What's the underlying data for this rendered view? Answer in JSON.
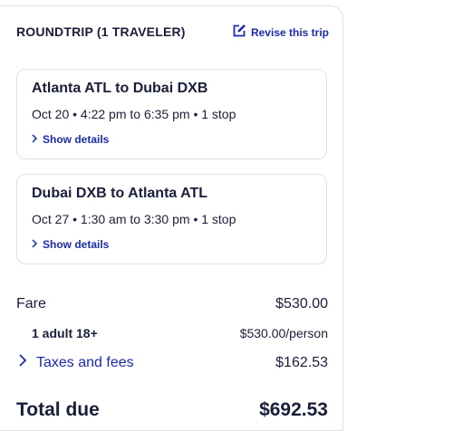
{
  "header": {
    "title": "ROUNDTRIP (1 TRAVELER)",
    "revise_label": "Revise this trip"
  },
  "legs": [
    {
      "route": "Atlanta ATL to Dubai DXB",
      "times": "Oct 20 • 4:22 pm to 6:35 pm • 1 stop",
      "details_label": "Show details"
    },
    {
      "route": "Dubai DXB to Atlanta ATL",
      "times": "Oct 27 • 1:30 am to 3:30 pm • 1 stop",
      "details_label": "Show details"
    }
  ],
  "price": {
    "fare_label": "Fare",
    "fare_value": "$530.00",
    "adult_label": "1 adult 18+",
    "adult_value": "$530.00/person",
    "taxes_label": "Taxes and fees",
    "taxes_value": "$162.53",
    "total_label": "Total due",
    "total_value": "$692.53"
  },
  "icons": {
    "revise": "edit-icon",
    "details": "chevron-right-icon",
    "taxes": "chevron-right-icon"
  },
  "colors": {
    "link": "#1a2bb0",
    "text": "#191e3b",
    "border": "#dfe0e4"
  }
}
